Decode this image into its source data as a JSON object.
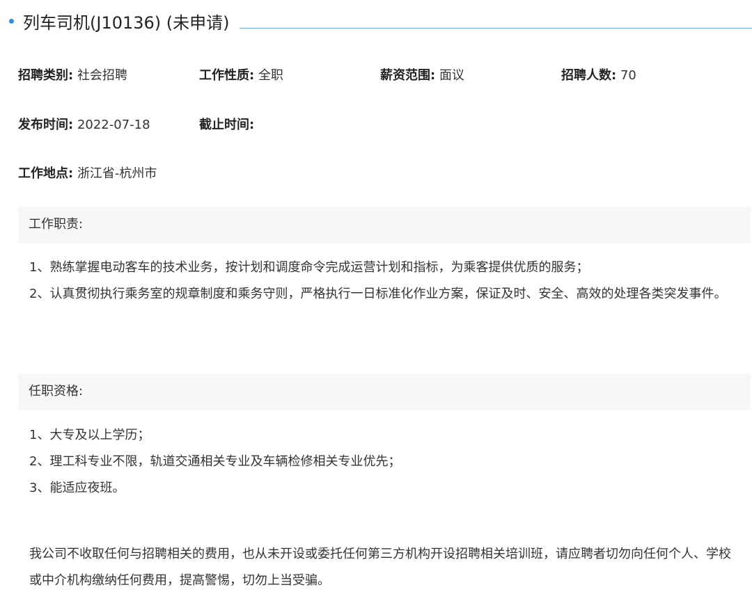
{
  "job": {
    "title": "列车司机(J10136) (未申请)"
  },
  "meta": {
    "category_label": "招聘类别:",
    "category_value": "社会招聘",
    "nature_label": "工作性质:",
    "nature_value": "全职",
    "salary_label": "薪资范围:",
    "salary_value": "面议",
    "headcount_label": "招聘人数:",
    "headcount_value": "70",
    "publish_label": "发布时间:",
    "publish_value": "2022-07-18",
    "deadline_label": "截止时间:",
    "deadline_value": "",
    "location_label": "工作地点:",
    "location_value": "浙江省-杭州市"
  },
  "duties": {
    "heading": "工作职责:",
    "items": [
      "1、熟练掌握电动客车的技术业务，按计划和调度命令完成运营计划和指标，为乘客提供优质的服务；",
      "2、认真贯彻执行乘务室的规章制度和乘务守则，严格执行一日标准化作业方案，保证及时、安全、高效的处理各类突发事件。"
    ]
  },
  "requirements": {
    "heading": "任职资格:",
    "items": [
      "1、大专及以上学历；",
      "2、理工科专业不限，轨道交通相关专业及车辆检修相关专业优先；",
      "3、能适应夜班。"
    ]
  },
  "notice": {
    "text": "我公司不收取任何与招聘相关的费用，也从未开设或委托任何第三方机构开设招聘相关培训班，请应聘者切勿向任何个人、学校或中介机构缴纳任何费用，提高警惕，切勿上当受骗。"
  },
  "colors": {
    "accent": "#2b8fe8",
    "section_bg": "#f7f7f7"
  }
}
